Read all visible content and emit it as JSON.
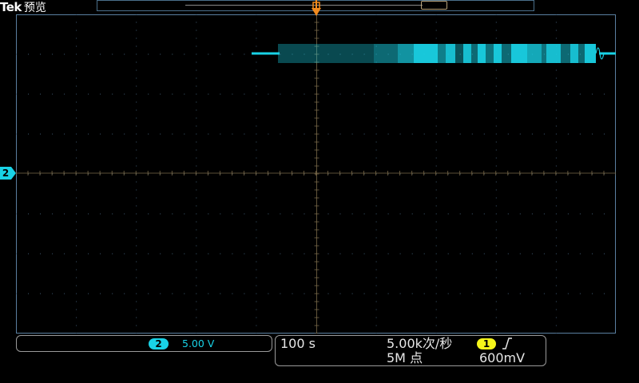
{
  "header": {
    "brand": "Tek",
    "mode": "预览"
  },
  "colors": {
    "ch2": "#19d2e6",
    "ch1_trigger": "#f5f51a",
    "trigger_marker": "#f08a1e",
    "graticule": "#5a7fa0",
    "background": "#000000"
  },
  "channel2": {
    "marker_label": "2",
    "badge": "2",
    "scale": "5.00 V"
  },
  "acquisition": {
    "timebase": "100 s",
    "sample_rate": "5.00k次/秒",
    "record_length": "5M 点"
  },
  "trigger": {
    "source_badge": "1",
    "slope_icon": "rising-edge-icon",
    "level": "600mV"
  }
}
